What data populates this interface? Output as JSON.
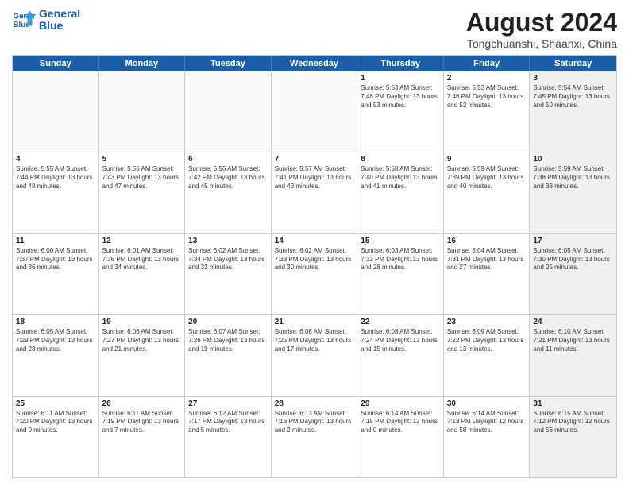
{
  "header": {
    "logo_line1": "General",
    "logo_line2": "Blue",
    "month_title": "August 2024",
    "location": "Tongchuanshi, Shaanxi, China"
  },
  "weekdays": [
    "Sunday",
    "Monday",
    "Tuesday",
    "Wednesday",
    "Thursday",
    "Friday",
    "Saturday"
  ],
  "rows": [
    [
      {
        "day": "",
        "text": "",
        "empty": true
      },
      {
        "day": "",
        "text": "",
        "empty": true
      },
      {
        "day": "",
        "text": "",
        "empty": true
      },
      {
        "day": "",
        "text": "",
        "empty": true
      },
      {
        "day": "1",
        "text": "Sunrise: 5:53 AM\nSunset: 7:46 PM\nDaylight: 13 hours\nand 53 minutes.",
        "empty": false
      },
      {
        "day": "2",
        "text": "Sunrise: 5:53 AM\nSunset: 7:46 PM\nDaylight: 13 hours\nand 52 minutes.",
        "empty": false
      },
      {
        "day": "3",
        "text": "Sunrise: 5:54 AM\nSunset: 7:45 PM\nDaylight: 13 hours\nand 50 minutes.",
        "empty": false,
        "shaded": true
      }
    ],
    [
      {
        "day": "4",
        "text": "Sunrise: 5:55 AM\nSunset: 7:44 PM\nDaylight: 13 hours\nand 48 minutes.",
        "empty": false
      },
      {
        "day": "5",
        "text": "Sunrise: 5:56 AM\nSunset: 7:43 PM\nDaylight: 13 hours\nand 47 minutes.",
        "empty": false
      },
      {
        "day": "6",
        "text": "Sunrise: 5:56 AM\nSunset: 7:42 PM\nDaylight: 13 hours\nand 45 minutes.",
        "empty": false
      },
      {
        "day": "7",
        "text": "Sunrise: 5:57 AM\nSunset: 7:41 PM\nDaylight: 13 hours\nand 43 minutes.",
        "empty": false
      },
      {
        "day": "8",
        "text": "Sunrise: 5:58 AM\nSunset: 7:40 PM\nDaylight: 13 hours\nand 41 minutes.",
        "empty": false
      },
      {
        "day": "9",
        "text": "Sunrise: 5:59 AM\nSunset: 7:39 PM\nDaylight: 13 hours\nand 40 minutes.",
        "empty": false
      },
      {
        "day": "10",
        "text": "Sunrise: 5:59 AM\nSunset: 7:38 PM\nDaylight: 13 hours\nand 38 minutes.",
        "empty": false,
        "shaded": true
      }
    ],
    [
      {
        "day": "11",
        "text": "Sunrise: 6:00 AM\nSunset: 7:37 PM\nDaylight: 13 hours\nand 36 minutes.",
        "empty": false
      },
      {
        "day": "12",
        "text": "Sunrise: 6:01 AM\nSunset: 7:36 PM\nDaylight: 13 hours\nand 34 minutes.",
        "empty": false
      },
      {
        "day": "13",
        "text": "Sunrise: 6:02 AM\nSunset: 7:34 PM\nDaylight: 13 hours\nand 32 minutes.",
        "empty": false
      },
      {
        "day": "14",
        "text": "Sunrise: 6:02 AM\nSunset: 7:33 PM\nDaylight: 13 hours\nand 30 minutes.",
        "empty": false
      },
      {
        "day": "15",
        "text": "Sunrise: 6:03 AM\nSunset: 7:32 PM\nDaylight: 13 hours\nand 28 minutes.",
        "empty": false
      },
      {
        "day": "16",
        "text": "Sunrise: 6:04 AM\nSunset: 7:31 PM\nDaylight: 13 hours\nand 27 minutes.",
        "empty": false
      },
      {
        "day": "17",
        "text": "Sunrise: 6:05 AM\nSunset: 7:30 PM\nDaylight: 13 hours\nand 25 minutes.",
        "empty": false,
        "shaded": true
      }
    ],
    [
      {
        "day": "18",
        "text": "Sunrise: 6:05 AM\nSunset: 7:29 PM\nDaylight: 13 hours\nand 23 minutes.",
        "empty": false
      },
      {
        "day": "19",
        "text": "Sunrise: 6:06 AM\nSunset: 7:27 PM\nDaylight: 13 hours\nand 21 minutes.",
        "empty": false
      },
      {
        "day": "20",
        "text": "Sunrise: 6:07 AM\nSunset: 7:26 PM\nDaylight: 13 hours\nand 19 minutes.",
        "empty": false
      },
      {
        "day": "21",
        "text": "Sunrise: 6:08 AM\nSunset: 7:25 PM\nDaylight: 13 hours\nand 17 minutes.",
        "empty": false
      },
      {
        "day": "22",
        "text": "Sunrise: 6:08 AM\nSunset: 7:24 PM\nDaylight: 13 hours\nand 15 minutes.",
        "empty": false
      },
      {
        "day": "23",
        "text": "Sunrise: 6:09 AM\nSunset: 7:22 PM\nDaylight: 13 hours\nand 13 minutes.",
        "empty": false
      },
      {
        "day": "24",
        "text": "Sunrise: 6:10 AM\nSunset: 7:21 PM\nDaylight: 13 hours\nand 11 minutes.",
        "empty": false,
        "shaded": true
      }
    ],
    [
      {
        "day": "25",
        "text": "Sunrise: 6:11 AM\nSunset: 7:20 PM\nDaylight: 13 hours\nand 9 minutes.",
        "empty": false
      },
      {
        "day": "26",
        "text": "Sunrise: 6:11 AM\nSunset: 7:19 PM\nDaylight: 13 hours\nand 7 minutes.",
        "empty": false
      },
      {
        "day": "27",
        "text": "Sunrise: 6:12 AM\nSunset: 7:17 PM\nDaylight: 13 hours\nand 5 minutes.",
        "empty": false
      },
      {
        "day": "28",
        "text": "Sunrise: 6:13 AM\nSunset: 7:16 PM\nDaylight: 13 hours\nand 2 minutes.",
        "empty": false
      },
      {
        "day": "29",
        "text": "Sunrise: 6:14 AM\nSunset: 7:15 PM\nDaylight: 13 hours\nand 0 minutes.",
        "empty": false
      },
      {
        "day": "30",
        "text": "Sunrise: 6:14 AM\nSunset: 7:13 PM\nDaylight: 12 hours\nand 58 minutes.",
        "empty": false
      },
      {
        "day": "31",
        "text": "Sunrise: 6:15 AM\nSunset: 7:12 PM\nDaylight: 12 hours\nand 56 minutes.",
        "empty": false,
        "shaded": true
      }
    ]
  ]
}
